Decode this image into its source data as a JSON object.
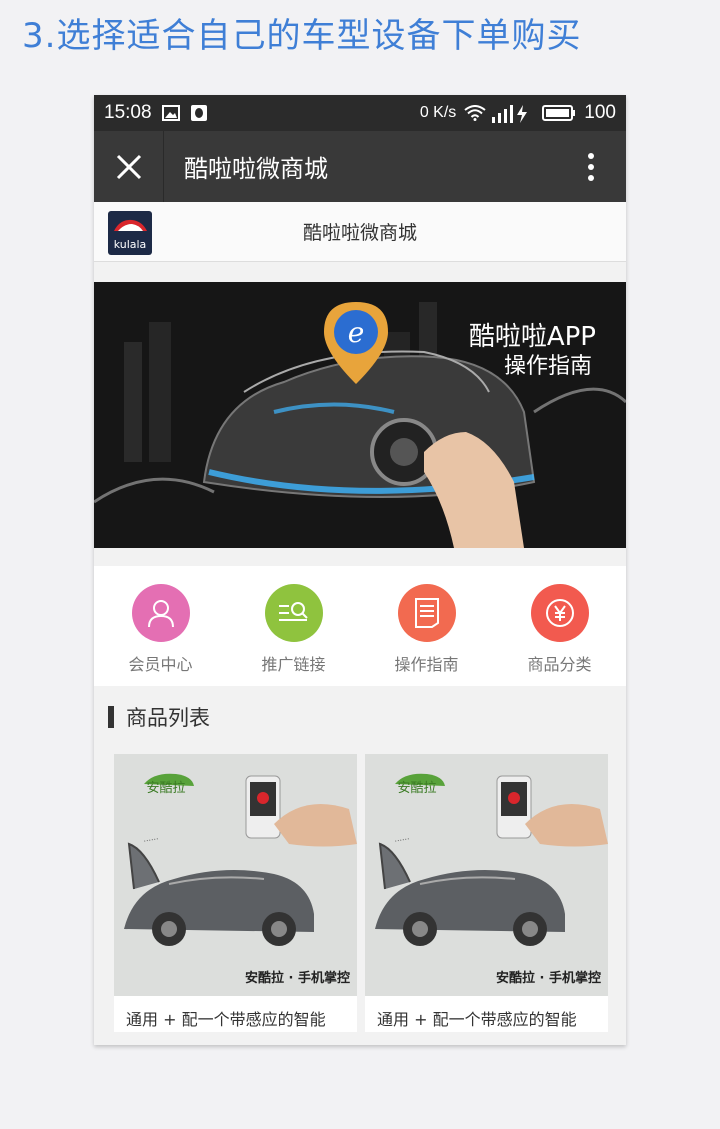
{
  "step_title": "3.选择适合自己的车型设备下单购买",
  "status_bar": {
    "time": "15:08",
    "net_speed": "0 K/s",
    "battery": "100"
  },
  "nav": {
    "title": "酷啦啦微商城"
  },
  "shop": {
    "name": "酷啦啦微商城",
    "logo_text": "kulala"
  },
  "banner": {
    "title": "酷啦啦APP",
    "subtitle": "操作指南"
  },
  "quick_nav": [
    {
      "label": "会员中心",
      "icon": "user-icon",
      "color": "#e46fb3"
    },
    {
      "label": "推广链接",
      "icon": "list-search-icon",
      "color": "#8fc33e"
    },
    {
      "label": "操作指南",
      "icon": "document-icon",
      "color": "#f26a50"
    },
    {
      "label": "商品分类",
      "icon": "yen-icon",
      "color": "#f25a4f"
    }
  ],
  "section": {
    "title": "商品列表"
  },
  "products": [
    {
      "name": "通用 + 配一个带感应的智能",
      "brand": "安酷拉",
      "tagline": "安酷拉 · 手机掌控"
    },
    {
      "name": "通用 + 配一个带感应的智能",
      "brand": "安酷拉",
      "tagline": "安酷拉 · 手机掌控"
    }
  ]
}
